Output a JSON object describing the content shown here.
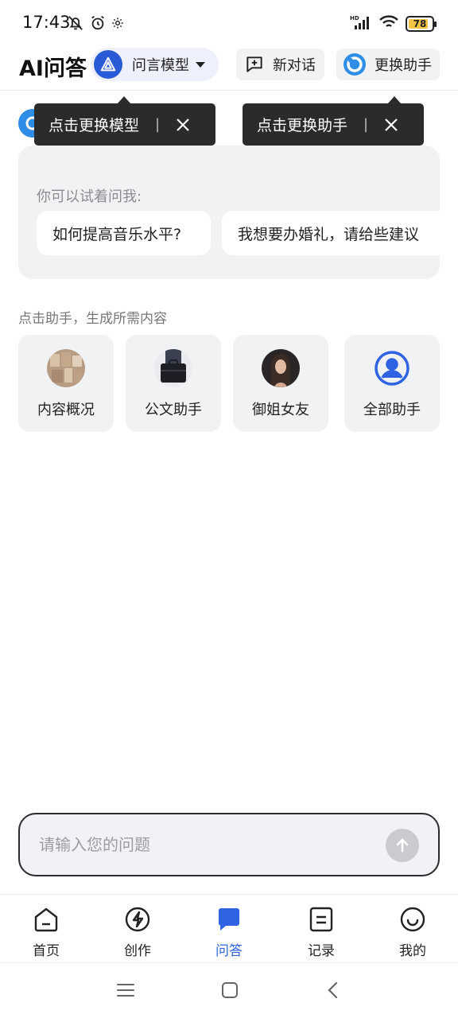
{
  "status_bar": {
    "time": "17:43",
    "battery": "78",
    "network": "HD"
  },
  "header": {
    "title": "AI问答",
    "model_label": "问言模型",
    "new_chat_label": "新对话",
    "switch_assistant_label": "更换助手"
  },
  "tooltips": {
    "model": "点击更换模型",
    "assistant": "点击更换助手",
    "separator": "|"
  },
  "suggestions": {
    "title": "你可以试着问我:",
    "items": [
      "如何提高音乐水平?",
      "我想要办婚礼，请给些建议"
    ]
  },
  "assistants_section": {
    "label": "点击助手，生成所需内容",
    "items": [
      {
        "name": "内容概况",
        "avatar": "books-photo"
      },
      {
        "name": "公文助手",
        "avatar": "briefcase-photo"
      },
      {
        "name": "御姐女友",
        "avatar": "woman-portrait"
      },
      {
        "name": "全部助手",
        "avatar": "user-circle-icon"
      }
    ]
  },
  "input": {
    "placeholder": "请输入您的问题"
  },
  "bottom_nav": {
    "items": [
      {
        "label": "首页",
        "icon": "home-icon"
      },
      {
        "label": "创作",
        "icon": "lightning-icon"
      },
      {
        "label": "问答",
        "icon": "chat-bubble-icon",
        "active": true
      },
      {
        "label": "记录",
        "icon": "record-icon"
      },
      {
        "label": "我的",
        "icon": "smiley-icon"
      }
    ]
  },
  "colors": {
    "accent": "#2f63e3",
    "tooltip_bg": "#2b2b2d",
    "card_bg": "#f1f2f4"
  }
}
